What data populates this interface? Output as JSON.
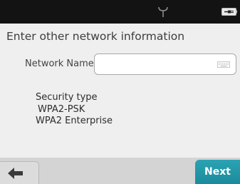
{
  "status_bar": {
    "icons": [
      "antenna-icon",
      "battery-icon"
    ]
  },
  "form": {
    "title": "Enter other network information",
    "network_name_label": "Network Name",
    "network_name_value": ""
  },
  "security": {
    "heading": "Security type",
    "options": [
      "WPA2-PSK",
      "WPA2 Enterprise"
    ]
  },
  "navigation": {
    "back_icon": "left-arrow-icon",
    "next_label": "Next"
  },
  "colors": {
    "accent": "#1f95a6",
    "status_bar": "#131313",
    "background": "#efefef"
  }
}
